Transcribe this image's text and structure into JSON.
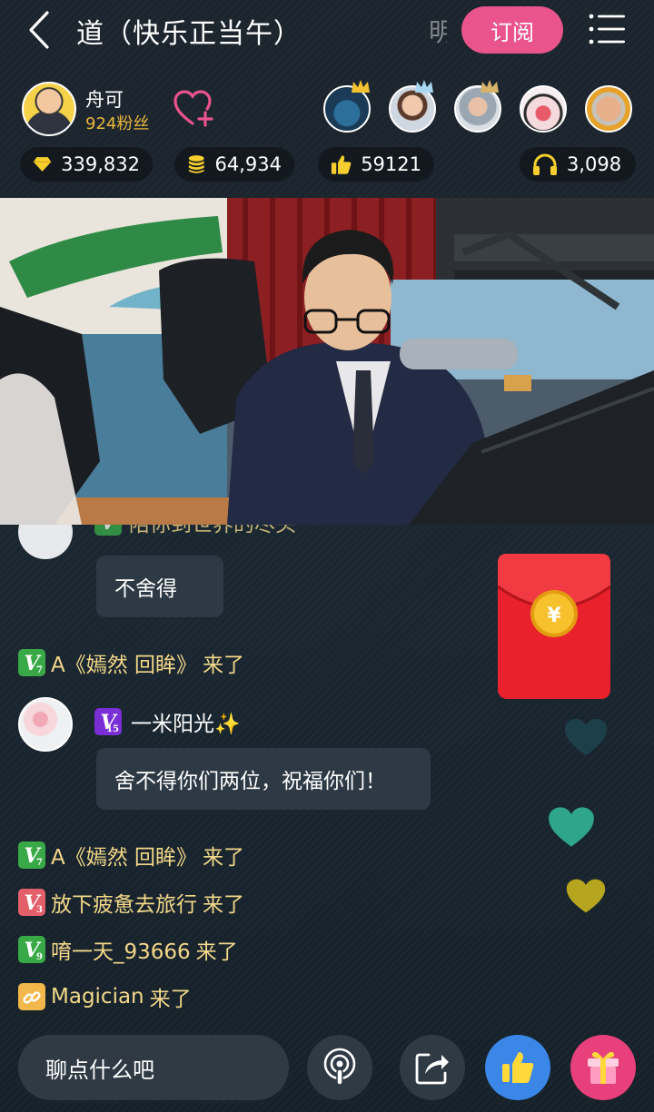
{
  "header": {
    "title": "道（快乐正当午）",
    "title_overflow": "明",
    "subscribe_label": "订阅"
  },
  "host": {
    "name": "舟可",
    "fans": "924粉丝"
  },
  "stats": {
    "diamonds": "339,832",
    "coins": "64,934",
    "likes": "59121",
    "listeners": "3,098"
  },
  "chat": {
    "partial_text": "陪你到世界的尽头",
    "messages": [
      {
        "type": "bubble",
        "text": "不舍得"
      },
      {
        "type": "system",
        "level": "7",
        "badge_color": "#39a847",
        "name": "A《嫣然 回眸》",
        "action": "来了"
      },
      {
        "type": "user",
        "level": "15",
        "badge_color": "#7a2fd6",
        "name": "一米阳光✨",
        "text": "舍不得你们两位，祝福你们！"
      },
      {
        "type": "system",
        "level": "7",
        "badge_color": "#39a847",
        "name": "A《嫣然 回眸》",
        "action": "来了"
      },
      {
        "type": "system",
        "level": "3",
        "badge_color": "#e35f6a",
        "name": "放下疲惫去旅行",
        "action": "来了"
      },
      {
        "type": "system",
        "level": "9",
        "badge_color": "#39a847",
        "name": "唷一天_93666",
        "action": "来了"
      },
      {
        "type": "system",
        "level": "",
        "badge_color": "#f2b84b",
        "name": "Magician",
        "action": "来了"
      }
    ]
  },
  "input": {
    "placeholder": "聊点什么吧"
  },
  "colors": {
    "accent_pink": "#e9548c",
    "fans_gold": "#e8b63a",
    "system_text": "#f3d88a",
    "red_packet": "#e8212c",
    "like_blue": "#3b87e8",
    "gift_pink": "#e8407a"
  },
  "icons": [
    "back-icon",
    "menu-icon",
    "follow-heart-icon",
    "diamond-icon",
    "coins-icon",
    "thumbs-up-icon",
    "headphones-icon",
    "podcast-icon",
    "share-icon",
    "gift-icon",
    "red-packet-icon",
    "yuan-coin-icon",
    "heart-icon",
    "crown-icon"
  ]
}
